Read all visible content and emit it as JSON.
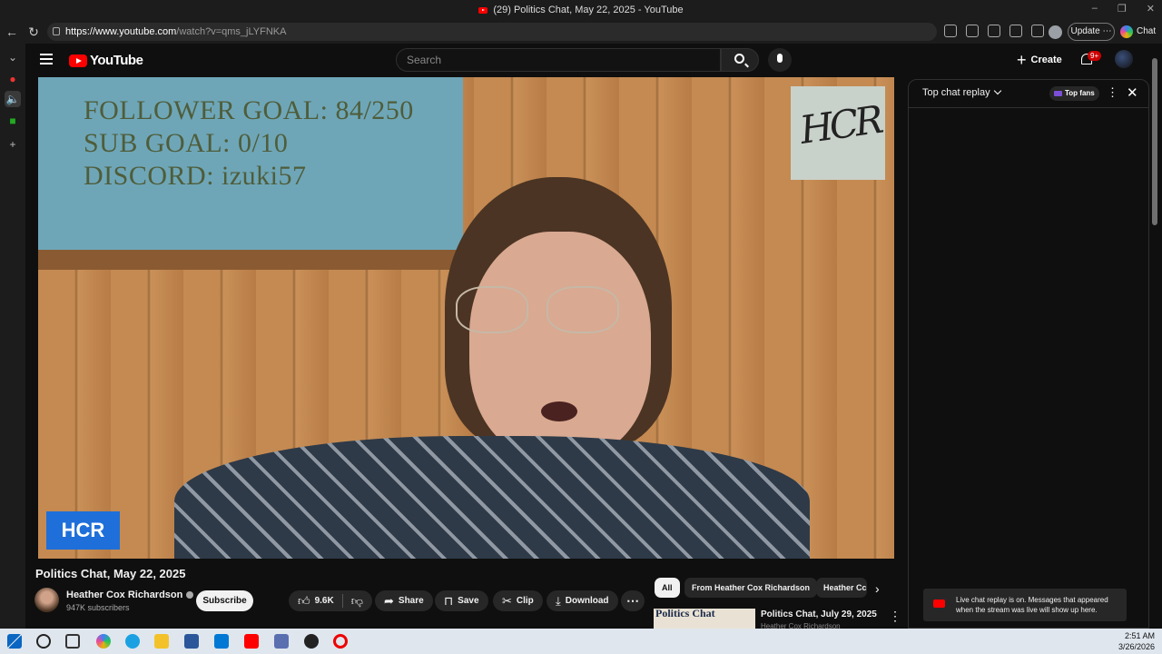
{
  "browser": {
    "tab_title": "(29) Politics Chat, May 22, 2025 - YouTube",
    "url_host": "https://www.youtube.com",
    "url_path": "/watch?v=qms_jLYFNKA",
    "update_label": "Update",
    "chat_label": "Chat"
  },
  "header": {
    "logo_text": "YouTube",
    "search_placeholder": "Search",
    "create_label": "Create",
    "notification_badge": "9+"
  },
  "video": {
    "overlay_lines": [
      "FOLLOWER GOAL:  84/250",
      "SUB GOAL: 0/10",
      "DISCORD: izuki57"
    ],
    "sign_text": "HCR",
    "corner_badge": "HCR",
    "title": "Politics Chat, May 22, 2025"
  },
  "channel": {
    "name": "Heather Cox Richardson",
    "subscribers": "947K subscribers",
    "subscribe_label": "Subscribe"
  },
  "actions": {
    "likes": "9.6K",
    "share": "Share",
    "save": "Save",
    "clip": "Clip",
    "download": "Download"
  },
  "chips": [
    "All",
    "From Heather Cox Richardson",
    "Heather Cc"
  ],
  "recommendation": {
    "thumb_text": "Politics Chat",
    "title": "Politics Chat, July 29, 2025",
    "channel": "Heather Cox Richardson"
  },
  "chat": {
    "title": "Top chat replay",
    "top_fans": "Top fans",
    "notice": "Live chat replay is on. Messages that appeared when the stream was live will show up here."
  },
  "taskbar": {
    "time": "2:51 AM",
    "date": "3/26/2026"
  },
  "colors": {
    "brand_red": "#ff0000",
    "page_bg": "#0f0f0f",
    "hcr_blue": "#1e6fd9"
  }
}
